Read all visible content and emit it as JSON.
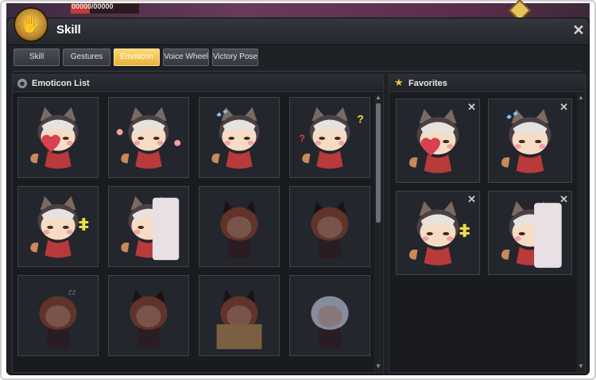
{
  "hud": {
    "hp_text": "00000/00000"
  },
  "window": {
    "title": "Skill",
    "close_label": "✕"
  },
  "tabs": [
    {
      "label": "Skill",
      "active": false
    },
    {
      "label": "Gestures",
      "active": false
    },
    {
      "label": "Emoticon",
      "active": true
    },
    {
      "label": "Voice Wheel",
      "active": false
    },
    {
      "label": "Victory Pose",
      "active": false
    }
  ],
  "emoticon_list": {
    "title": "Emoticon List",
    "items": [
      {
        "name": "raccoon-heart",
        "locked": false
      },
      {
        "name": "raccoon-flowers",
        "locked": false
      },
      {
        "name": "raccoon-sweat",
        "locked": false
      },
      {
        "name": "raccoon-question",
        "locked": false
      },
      {
        "name": "raccoon-laugh",
        "locked": false
      },
      {
        "name": "raccoon-peek",
        "locked": false
      },
      {
        "name": "girl-cat-ears-sparkle",
        "locked": true
      },
      {
        "name": "girl-cat-ears-stand",
        "locked": true
      },
      {
        "name": "girl-sleepy",
        "locked": true
      },
      {
        "name": "girl-glasses",
        "locked": true
      },
      {
        "name": "girl-box",
        "locked": true
      },
      {
        "name": "girl-sword",
        "locked": true
      }
    ]
  },
  "favorites": {
    "title": "Favorites",
    "remove_label": "✕",
    "items": [
      {
        "name": "raccoon-heart"
      },
      {
        "name": "raccoon-sweat"
      },
      {
        "name": "raccoon-laugh"
      },
      {
        "name": "raccoon-peek"
      }
    ]
  },
  "colors": {
    "accent_tab": "#f2c14e",
    "panel_bg": "#191b1f",
    "window_bg": "#1e2126"
  }
}
